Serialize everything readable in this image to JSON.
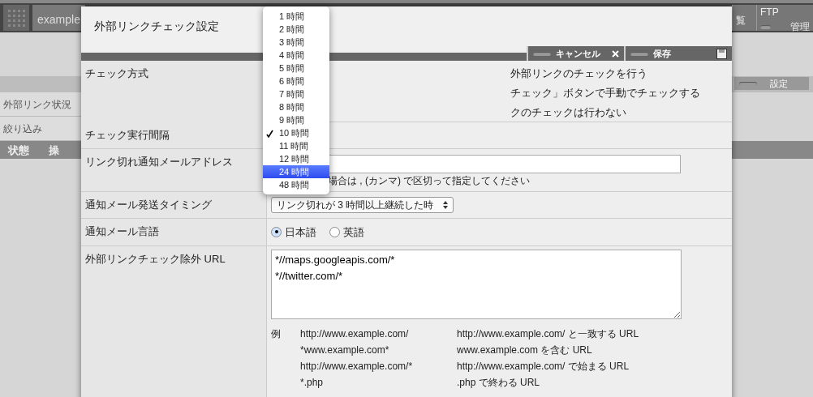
{
  "background": {
    "app_tab": "example",
    "nav_tabs": [
      {
        "label": "覧"
      },
      {
        "label": "FTP",
        "sublabel": "管理"
      }
    ],
    "side_items": [
      {
        "label": "外部リンク状況"
      },
      {
        "label": "絞り込み"
      }
    ],
    "settings_button": "設定",
    "table": {
      "columns": [
        "状態",
        "操"
      ]
    }
  },
  "dialog": {
    "title": "外部リンクチェック設定",
    "buttons": [
      {
        "label": "キャンセル",
        "kind": "close"
      },
      {
        "label": "保存",
        "kind": "save"
      }
    ],
    "rows": [
      {
        "label": "チェック方式",
        "kind": "lines",
        "lines": [
          "外部リンクのチェックを行う",
          "チェック」ボタンで手動でチェックする",
          "クのチェックは行わない"
        ]
      },
      {
        "label": "チェック実行間隔",
        "kind": "covered"
      },
      {
        "label": "リンク切れ通知メールアドレス",
        "kind": "input",
        "hint": "場合は , (カンマ) で区切って指定してください"
      },
      {
        "label": "通知メール発送タイミング",
        "kind": "select",
        "value": "リンク切れが 3 時間以上継続した時"
      },
      {
        "label": "通知メール言語",
        "kind": "radios",
        "options": [
          {
            "label": "日本語",
            "selected": true
          },
          {
            "label": "英語",
            "selected": false
          }
        ]
      },
      {
        "label": "外部リンクチェック除外 URL",
        "kind": "textarea",
        "value": "*//maps.googleapis.com/*\n*//twitter.com/*",
        "example_label": "例",
        "examples": [
          {
            "pattern": "http://www.example.com/",
            "meaning": "http://www.example.com/ と一致する URL"
          },
          {
            "pattern": "*www.example.com*",
            "meaning": "www.example.com を含む URL"
          },
          {
            "pattern": "http://www.example.com/*",
            "meaning": "http://www.example.com/ で始まる URL"
          },
          {
            "pattern": "*.php",
            "meaning": ".php で終わる URL"
          }
        ]
      }
    ]
  },
  "dropdown": {
    "options": [
      {
        "label": "1 時間",
        "checked": false,
        "selected": false
      },
      {
        "label": "2 時間",
        "checked": false,
        "selected": false
      },
      {
        "label": "3 時間",
        "checked": false,
        "selected": false
      },
      {
        "label": "4 時間",
        "checked": false,
        "selected": false
      },
      {
        "label": "5 時間",
        "checked": false,
        "selected": false
      },
      {
        "label": "6 時間",
        "checked": false,
        "selected": false
      },
      {
        "label": "7 時間",
        "checked": false,
        "selected": false
      },
      {
        "label": "8 時間",
        "checked": false,
        "selected": false
      },
      {
        "label": "9 時間",
        "checked": false,
        "selected": false
      },
      {
        "label": "10 時間",
        "checked": true,
        "selected": false
      },
      {
        "label": "11 時間",
        "checked": false,
        "selected": false
      },
      {
        "label": "12 時間",
        "checked": false,
        "selected": false
      },
      {
        "label": "24 時間",
        "checked": false,
        "selected": true
      },
      {
        "label": "48 時間",
        "checked": false,
        "selected": false
      }
    ]
  }
}
